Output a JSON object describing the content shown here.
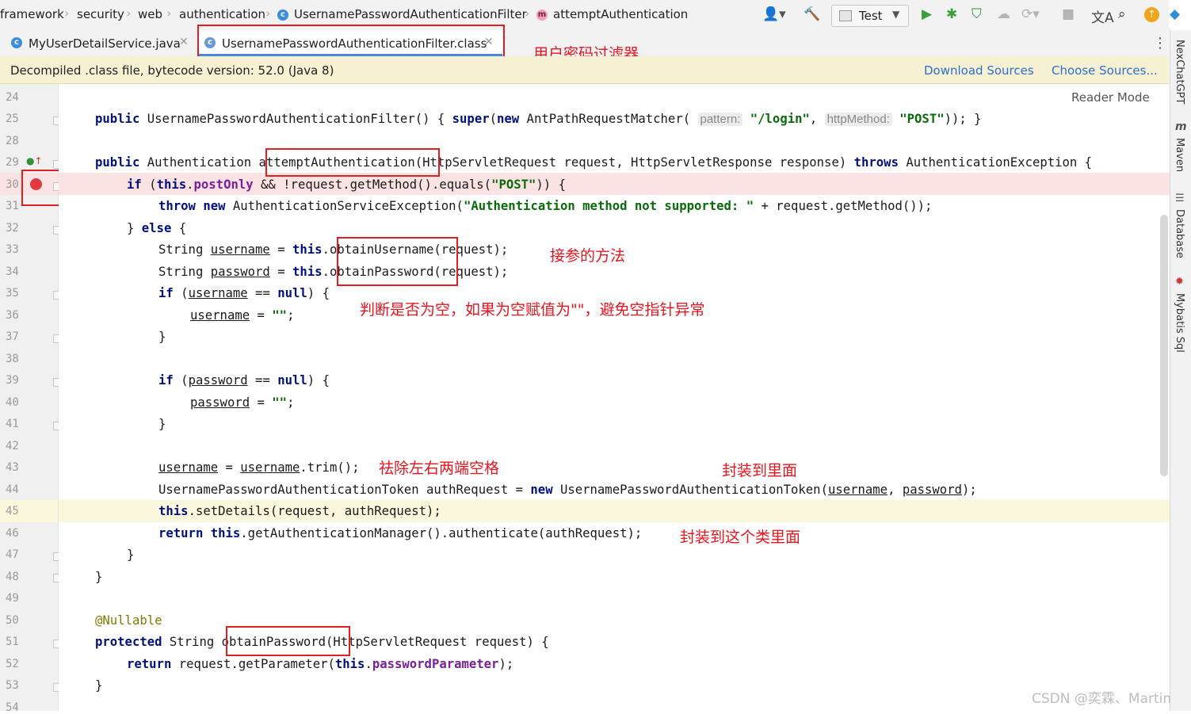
{
  "breadcrumb": {
    "items": [
      "framework",
      "security",
      "web",
      "authentication",
      "UsernamePasswordAuthenticationFilter",
      "attemptAuthentication"
    ]
  },
  "toolbar": {
    "run_config": "Test"
  },
  "tabs": [
    {
      "label": "MyUserDetailService.java",
      "active": false
    },
    {
      "label": "UsernamePasswordAuthenticationFilter.class",
      "active": true
    }
  ],
  "banner": {
    "message": "Decompiled .class file, bytecode version: 52.0 (Java 8)",
    "download_sources": "Download Sources",
    "choose_sources": "Choose Sources..."
  },
  "editor": {
    "reader_mode": "Reader Mode",
    "line_numbers": [
      "24",
      "25",
      "28",
      "29",
      "30",
      "31",
      "32",
      "33",
      "34",
      "35",
      "36",
      "37",
      "38",
      "39",
      "40",
      "41",
      "42",
      "43",
      "44",
      "45",
      "46",
      "47",
      "48",
      "49",
      "50",
      "51",
      "52",
      "53",
      "54"
    ],
    "code": {
      "l25": {
        "kw1": "public",
        "t1": " UsernamePasswordAuthenticationFilter() { ",
        "kw2": "super",
        "t2": "(",
        "kw3": "new",
        "t3": " AntPathRequestMatcher( ",
        "h1": "pattern:",
        "s1": "\"/login\"",
        "t4": ", ",
        "h2": "httpMethod:",
        "s2": "\"POST\"",
        "t5": ")); }"
      },
      "l29": {
        "kw1": "public",
        "t1": " Authentication attemptAuthentication(HttpServletRequest request, HttpServletResponse response) ",
        "kw2": "throws",
        "t2": " AuthenticationException {"
      },
      "l30": {
        "kw1": "if",
        "t1": " (",
        "kw2": "this",
        "t2": ".",
        "f1": "postOnly",
        "t3": " && !request.getMethod().equals(",
        "s1": "\"POST\"",
        "t4": ")) {"
      },
      "l31": {
        "kw1": "throw",
        "t1": " ",
        "kw2": "new",
        "t2": " AuthenticationServiceException(",
        "s1": "\"Authentication method not supported: \"",
        "t3": " + request.getMethod());"
      },
      "l32": {
        "t1": "} ",
        "kw1": "else",
        "t2": " {"
      },
      "l33": {
        "t1": "String ",
        "u1": "username",
        "t2": " = ",
        "kw1": "this",
        "t3": ".obtainUsername(request);"
      },
      "l34": {
        "t1": "String ",
        "u1": "password",
        "t2": " = ",
        "kw1": "this",
        "t3": ".obtainPassword(request);"
      },
      "l35": {
        "kw1": "if",
        "t1": " (",
        "u1": "username",
        "t2": " == ",
        "kw2": "null",
        "t3": ") {"
      },
      "l36": {
        "u1": "username",
        "t1": " = ",
        "s1": "\"\"",
        "t2": ";"
      },
      "l37": {
        "t1": "}"
      },
      "l39": {
        "kw1": "if",
        "t1": " (",
        "u1": "password",
        "t2": " == ",
        "kw2": "null",
        "t3": ") {"
      },
      "l40": {
        "u1": "password",
        "t1": " = ",
        "s1": "\"\"",
        "t2": ";"
      },
      "l41": {
        "t1": "}"
      },
      "l43": {
        "u1": "username",
        "t1": " = ",
        "u2": "username",
        "t2": ".trim();"
      },
      "l44": {
        "t1": "UsernamePasswordAuthenticationToken authRequest = ",
        "kw1": "new",
        "t2": " UsernamePasswordAuthenticationToken(",
        "u1": "username",
        "t3": ", ",
        "u2": "password",
        "t4": ");"
      },
      "l45": {
        "kw1": "this",
        "t1": ".setDetails(request, authRequest);"
      },
      "l46": {
        "kw1": "return",
        "t1": " ",
        "kw2": "this",
        "t2": ".getAuthenticationManager().authenticate(authRequest);"
      },
      "l47": {
        "t1": "}"
      },
      "l48": {
        "t1": "}"
      },
      "l50": {
        "a1": "@Nullable"
      },
      "l51": {
        "kw1": "protected",
        "t1": " String obtainPassword(HttpServletRequest request) {"
      },
      "l52": {
        "kw1": "return",
        "t1": " request.getParameter(",
        "kw2": "this",
        "t2": ".",
        "f1": "passwordParameter",
        "t3": ");"
      },
      "l53": {
        "t1": "}"
      }
    }
  },
  "annotations": {
    "filter_title": "用户密码过滤器",
    "get_params": "接参的方法",
    "null_check": "判断是否为空，如果为空赋值为\"\"，避免空指针异常",
    "trim": "祛除左右两端空格",
    "wrap_into": "封装到里面",
    "wrap_into_class": "封装到这个类里面"
  },
  "right_panel": {
    "items": [
      "NexChatGPT",
      "Maven",
      "Database",
      "Mybatis Sql"
    ]
  },
  "watermark": "CSDN @奕霖、Martin",
  "colors": {
    "keyword": "#00117f",
    "string": "#0a6b0a",
    "field": "#7a1e9c",
    "annotation_red": "#e8141e",
    "link": "#2e6fd1",
    "banner_bg": "#f6f1d2"
  }
}
